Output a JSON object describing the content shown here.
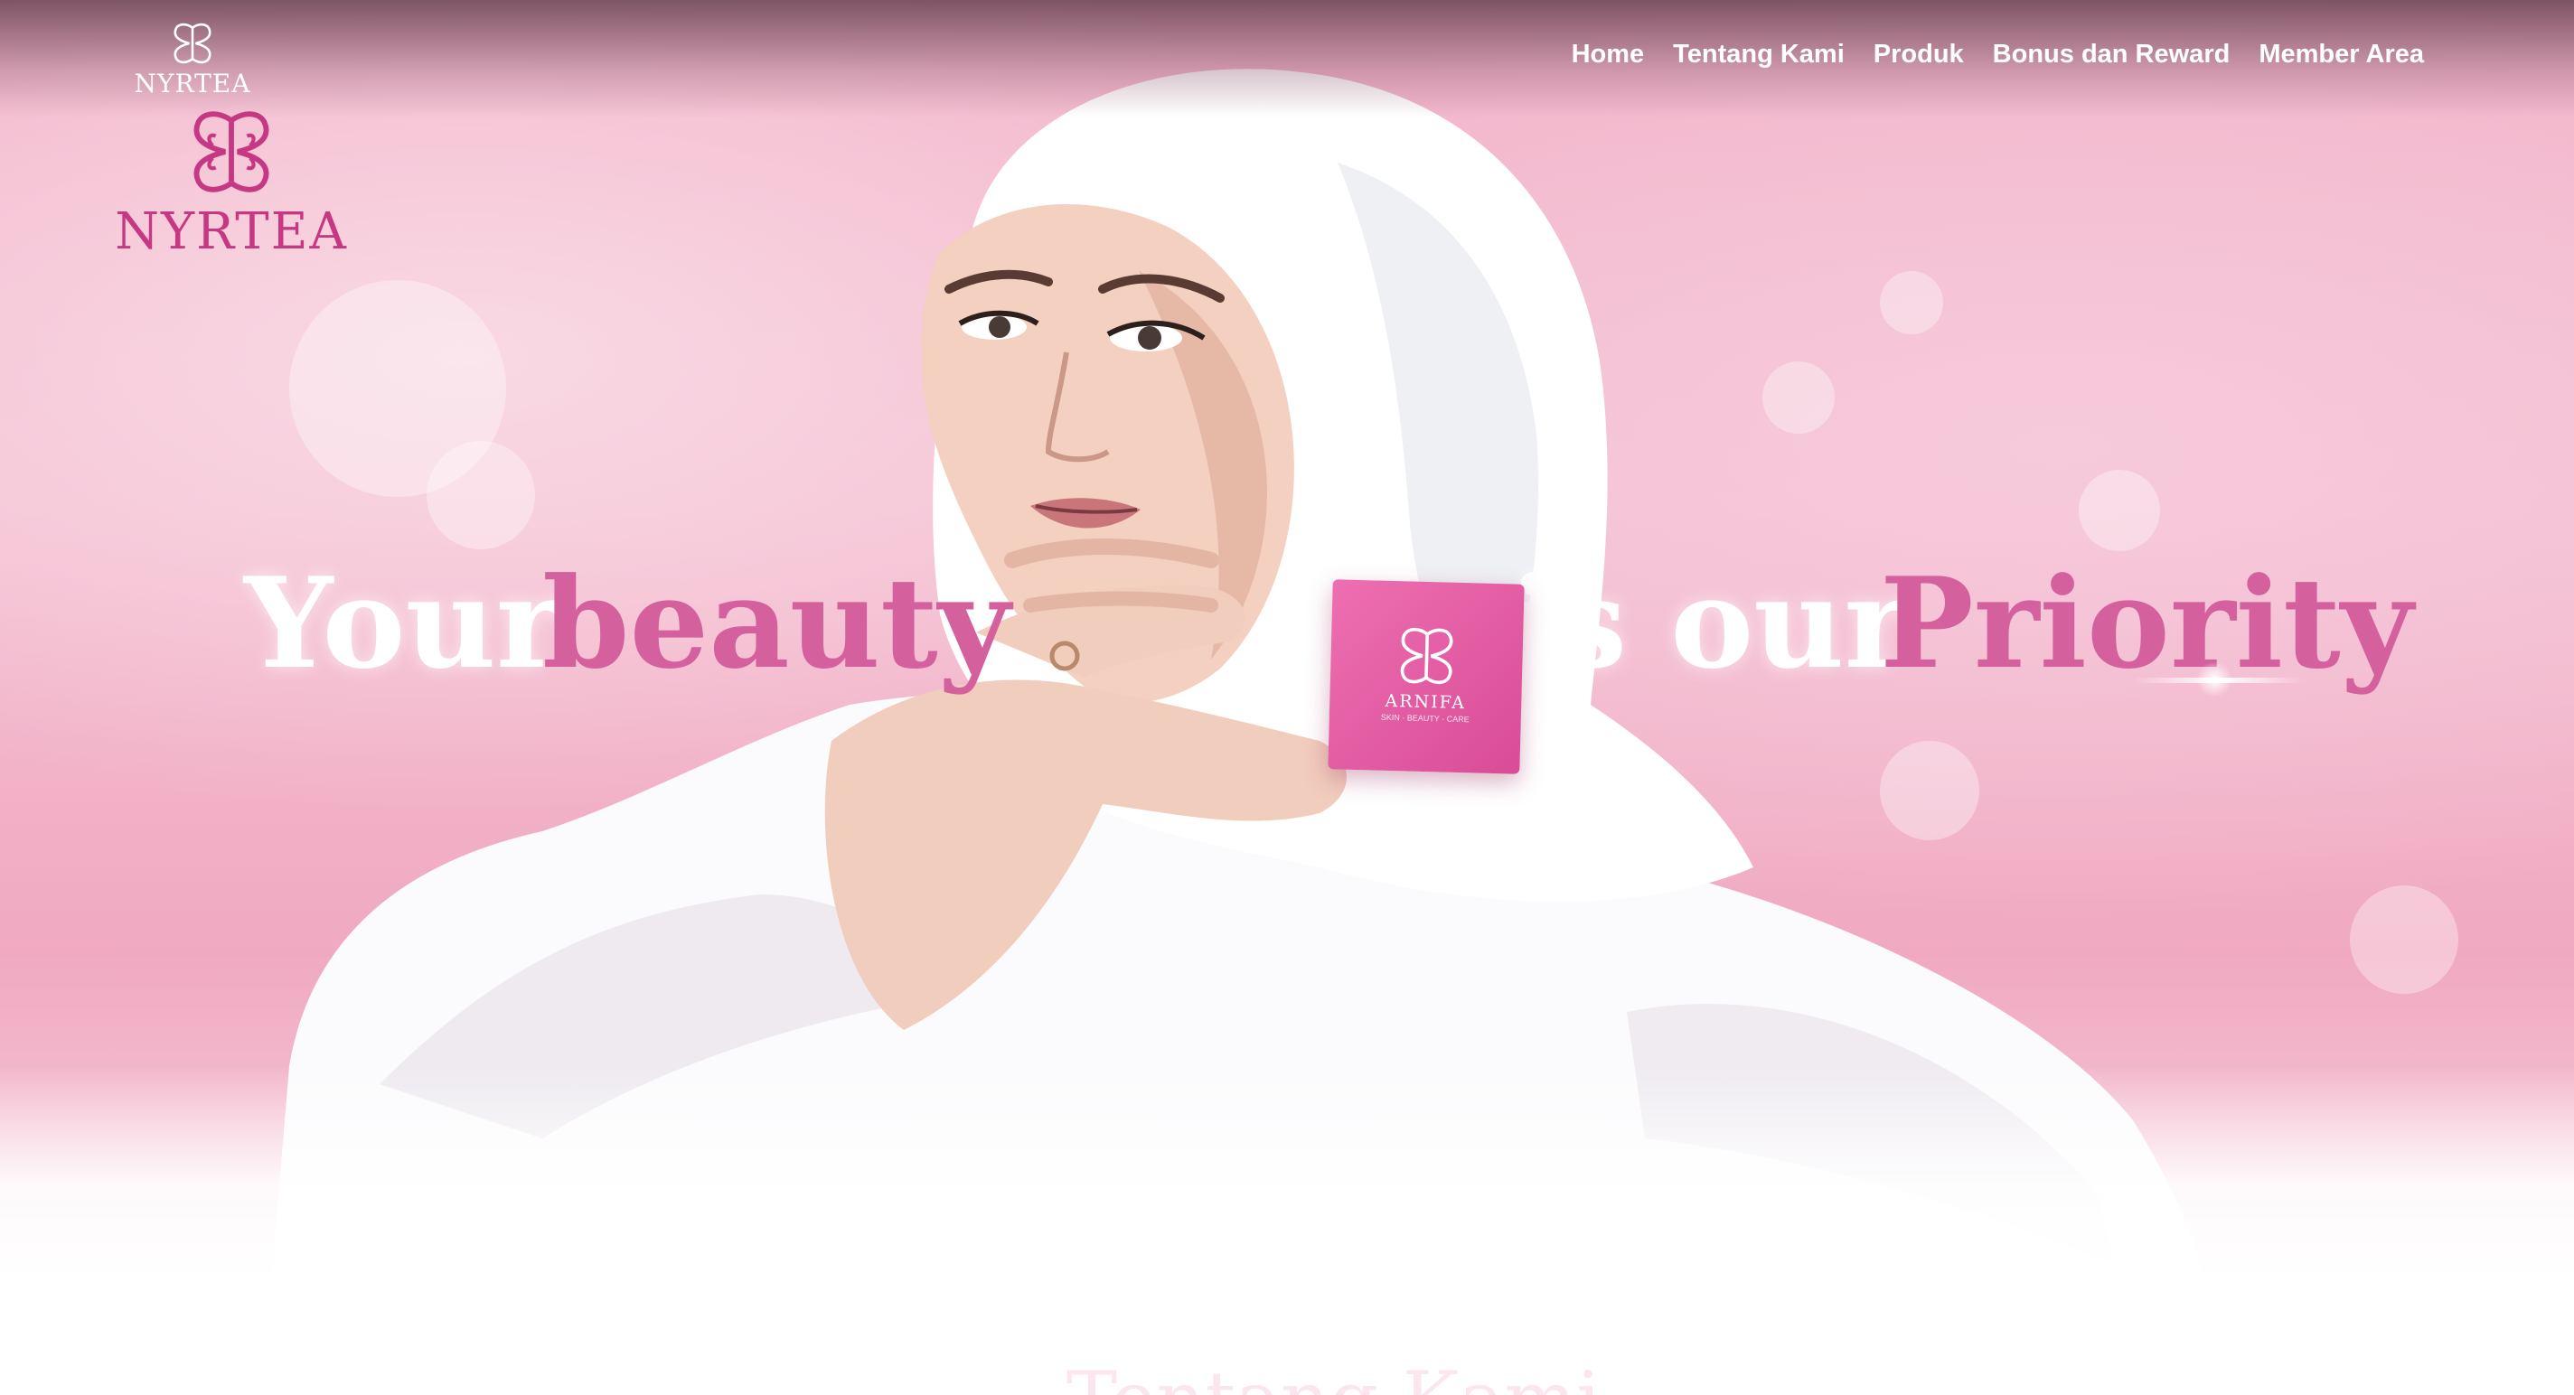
{
  "brand": {
    "name_small": "NYRTEA",
    "name_large": "NYRTEA",
    "accent_color": "#c73883"
  },
  "nav": {
    "items": [
      {
        "label": "Home"
      },
      {
        "label": "Tentang Kami"
      },
      {
        "label": "Produk"
      },
      {
        "label": "Bonus dan Reward"
      },
      {
        "label": "Member Area"
      }
    ]
  },
  "hero": {
    "headline": {
      "word1": "Your",
      "word2": "beauty",
      "word3": "is our",
      "word4": "Priority"
    },
    "product": {
      "brand": "ARNIFA",
      "tagline": "SKIN · BEAUTY · CARE"
    },
    "colors": {
      "headline_pink": "#d4619d",
      "background_pink": "#f2b3c9"
    }
  },
  "section": {
    "title": "Tentang Kami"
  }
}
